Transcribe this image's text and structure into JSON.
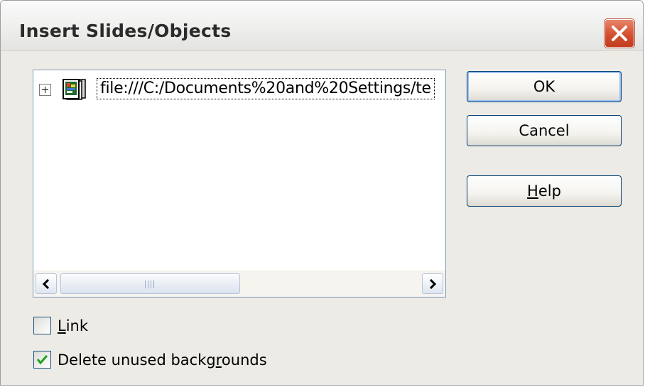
{
  "dialog": {
    "title": "Insert Slides/Objects",
    "close_icon": "close-icon"
  },
  "tree": {
    "items": [
      {
        "icon": "presentation-document-icon",
        "label": "file:///C:/Documents%20and%20Settings/te",
        "expanded": false
      }
    ],
    "scrollbar": {
      "left_arrow": "chevron-left-icon",
      "right_arrow": "chevron-right-icon",
      "grip_glyph": "III"
    }
  },
  "buttons": {
    "ok": "OK",
    "cancel": "Cancel",
    "help_mnemonic": "H",
    "help_rest": "elp"
  },
  "options": {
    "link": {
      "mnemonic": "L",
      "rest": "ink",
      "checked": false
    },
    "delete_unused": {
      "before": "Delete unused backg",
      "mnemonic": "r",
      "after": "ounds",
      "checked": true
    }
  },
  "colors": {
    "close_button": "#d3502f",
    "checkmark": "#21a121",
    "focus_border": "#003c74"
  }
}
